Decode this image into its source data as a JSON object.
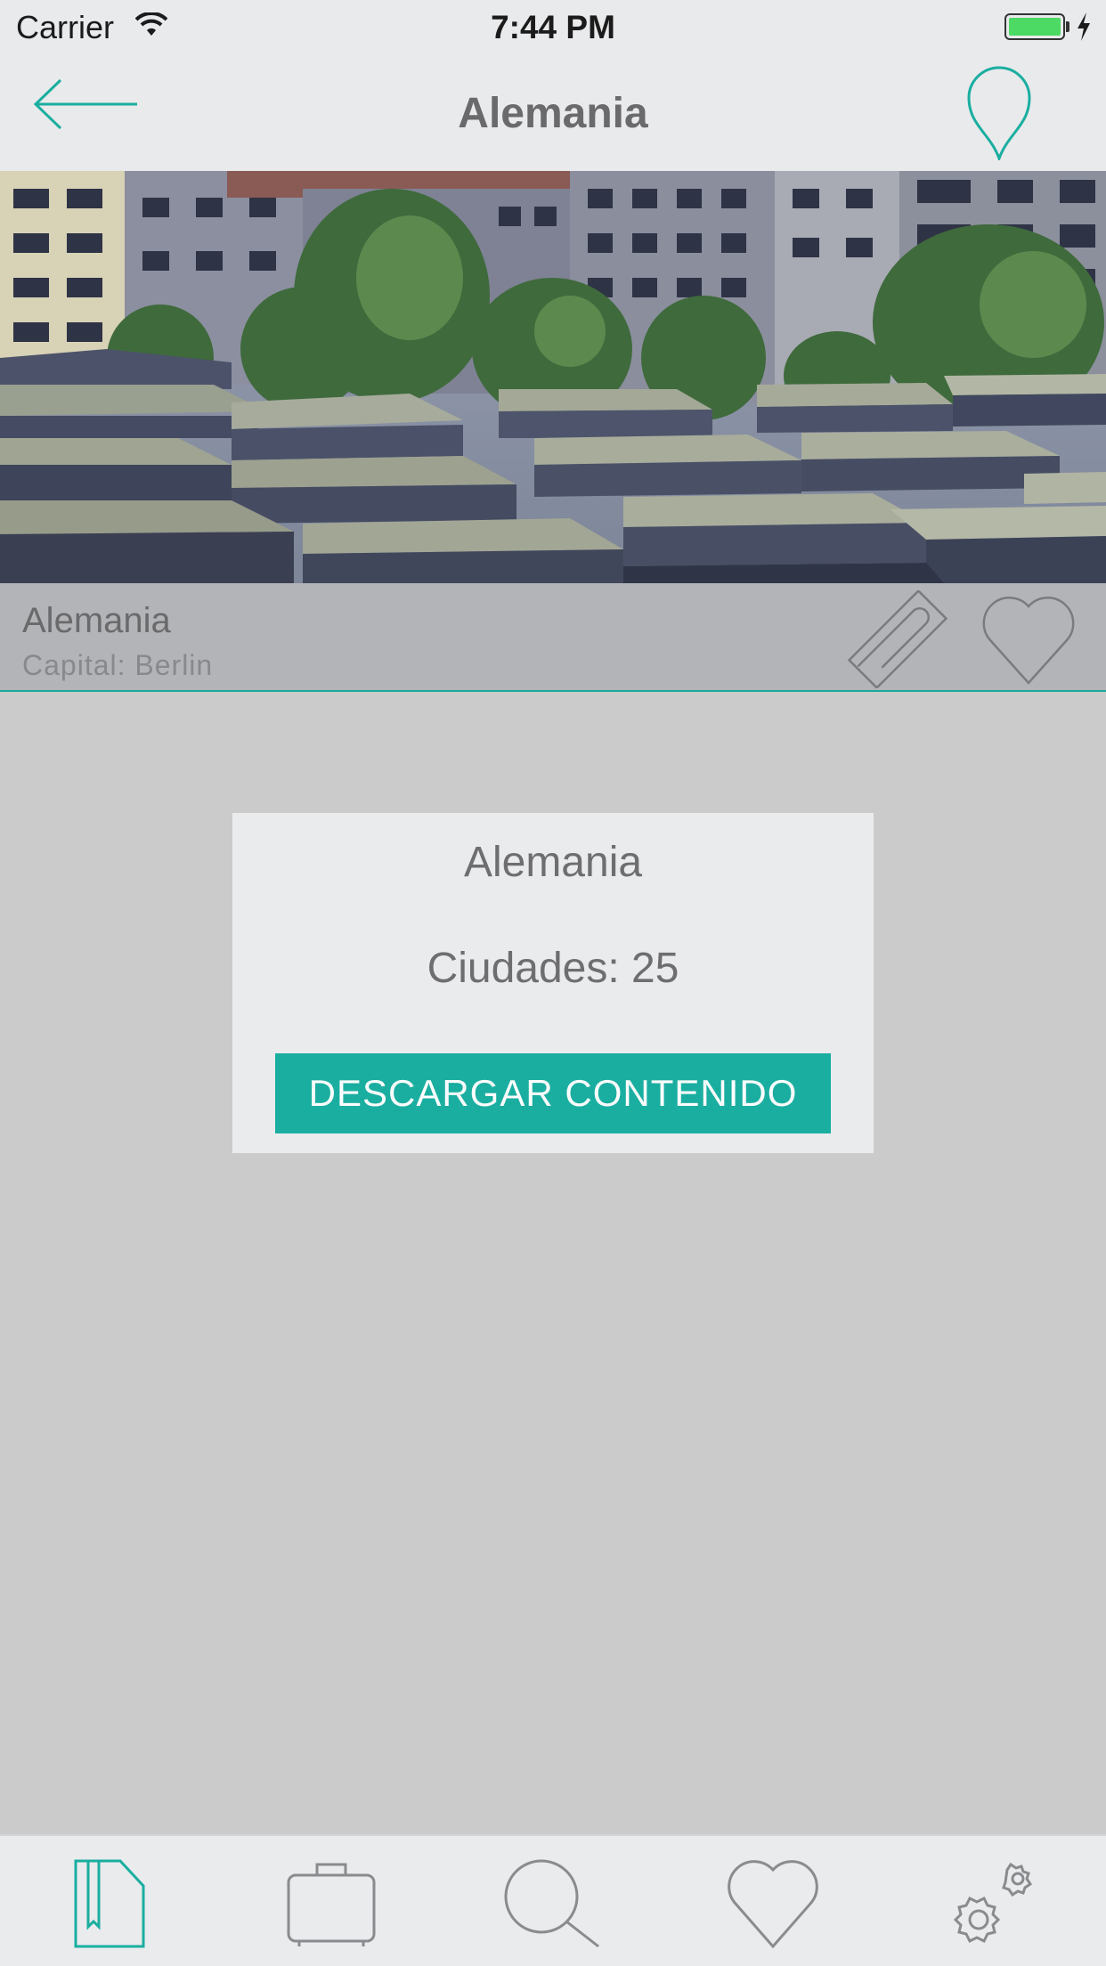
{
  "status_bar": {
    "carrier": "Carrier",
    "time": "7:44 PM",
    "battery_color": "#4cd964"
  },
  "nav": {
    "title": "Alemania",
    "back_icon": "arrow-left-icon",
    "right_icon": "map-pin-icon",
    "accent": "#1aaea0"
  },
  "hero": {
    "icon": "photo-memorial-berlin"
  },
  "info": {
    "name": "Alemania",
    "capital": "Capital: Berlin"
  },
  "card": {
    "title": "Alemania",
    "cities": "Ciudades: 25",
    "button_label": "DESCARGAR CONTENIDO"
  },
  "tabs": [
    {
      "icon": "guide-document-icon",
      "active": true
    },
    {
      "icon": "suitcase-icon",
      "active": false
    },
    {
      "icon": "search-icon",
      "active": false
    },
    {
      "icon": "heart-icon",
      "active": false
    },
    {
      "icon": "settings-gear-icon",
      "active": false
    }
  ]
}
